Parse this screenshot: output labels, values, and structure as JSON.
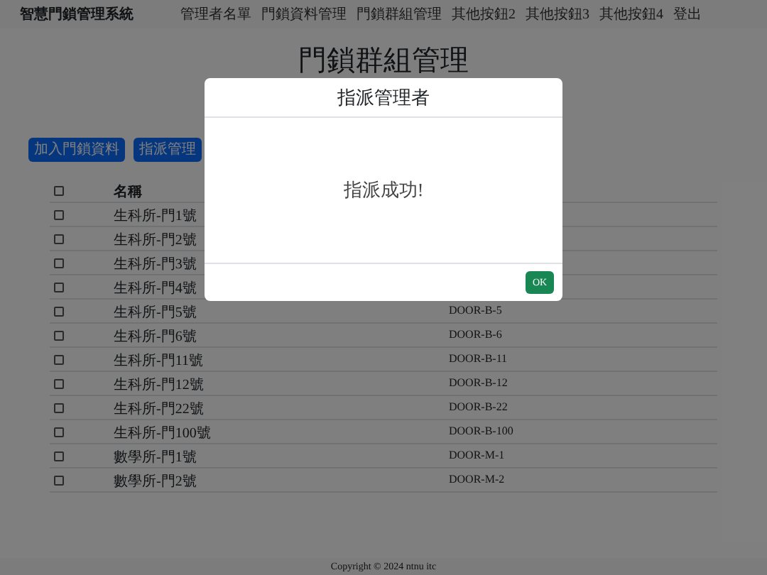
{
  "navbar": {
    "brand": "智慧門鎖管理系統",
    "links": [
      "管理者名單",
      "門鎖資料管理",
      "門鎖群組管理",
      "其他按鈕2",
      "其他按鈕3",
      "其他按鈕4",
      "登出"
    ]
  },
  "page_title": "門鎖群組管理",
  "buttons": [
    "加入門鎖資料",
    "指派管理"
  ],
  "table": {
    "header": {
      "checked": false,
      "name": "名稱"
    },
    "rows": [
      {
        "checked": false,
        "name": "生科所-門1號"
      },
      {
        "checked": false,
        "name": "生科所-門2號"
      },
      {
        "checked": false,
        "name": "生科所-門3號"
      },
      {
        "checked": false,
        "name": "生科所-門4號"
      },
      {
        "checked": false,
        "name": "生科所-門5號",
        "code": "DOOR-B-5"
      },
      {
        "checked": false,
        "name": "生科所-門6號",
        "code": "DOOR-B-6"
      },
      {
        "checked": false,
        "name": "生科所-門11號",
        "code": "DOOR-B-11"
      },
      {
        "checked": false,
        "name": "生科所-門12號",
        "code": "DOOR-B-12"
      },
      {
        "checked": false,
        "name": "生科所-門22號",
        "code": "DOOR-B-22"
      },
      {
        "checked": false,
        "name": "生科所-門100號",
        "code": "DOOR-B-100"
      },
      {
        "checked": false,
        "name": "數學所-門1號",
        "code": "DOOR-M-1"
      },
      {
        "checked": false,
        "name": "數學所-門2號",
        "code": "DOOR-M-2"
      }
    ]
  },
  "footer": "Copyright © 2024 ntnu itc",
  "modal": {
    "title": "指派管理者",
    "message": "指派成功!",
    "button": "OK"
  }
}
